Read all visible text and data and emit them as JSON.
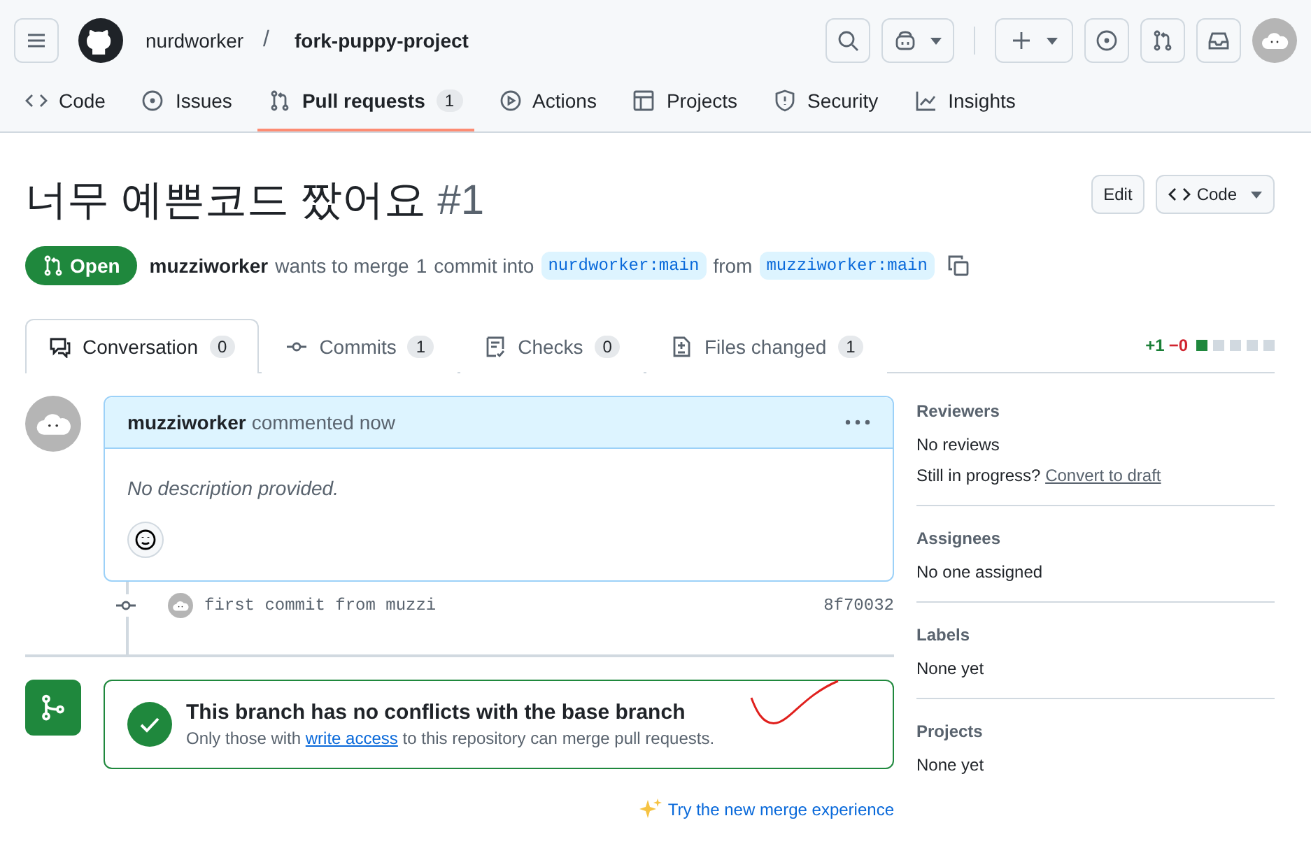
{
  "header": {
    "owner": "nurdworker",
    "separator": "/",
    "repo": "fork-puppy-project"
  },
  "repo_tabs": [
    {
      "label": "Code",
      "selected": false
    },
    {
      "label": "Issues",
      "selected": false
    },
    {
      "label": "Pull requests",
      "count": "1",
      "selected": true
    },
    {
      "label": "Actions",
      "selected": false
    },
    {
      "label": "Projects",
      "selected": false
    },
    {
      "label": "Security",
      "selected": false
    },
    {
      "label": "Insights",
      "selected": false
    }
  ],
  "pr": {
    "title": "너무 예쁜코드 짰어요",
    "number": "#1",
    "state": "Open",
    "author": "muzziworker",
    "merge_text_1": "wants to merge",
    "commit_count": "1",
    "merge_text_2": "commit into",
    "base": "nurdworker:main",
    "from": "from",
    "head": "muzziworker:main",
    "edit_button": "Edit",
    "code_button": "Code"
  },
  "pr_tabs": [
    {
      "label": "Conversation",
      "count": "0",
      "selected": true
    },
    {
      "label": "Commits",
      "count": "1",
      "selected": false
    },
    {
      "label": "Checks",
      "count": "0",
      "selected": false
    },
    {
      "label": "Files changed",
      "count": "1",
      "selected": false
    }
  ],
  "diffstat": {
    "added": "+1",
    "removed": "−0",
    "blocks": [
      {
        "kind": "added"
      },
      {
        "kind": "neutral"
      },
      {
        "kind": "neutral"
      },
      {
        "kind": "neutral"
      },
      {
        "kind": "neutral"
      }
    ]
  },
  "comment": {
    "author": "muzziworker",
    "action": "commented now",
    "body": "No description provided."
  },
  "commit": {
    "message": "first commit from muzzi",
    "sha": "8f70032"
  },
  "merge": {
    "title": "This branch has no conflicts with the base branch",
    "text_before": "Only those with",
    "link": "write access",
    "text_after": "to this repository can merge pull requests.",
    "try_link": "Try the new merge experience"
  },
  "sidebar": [
    {
      "heading": "Reviewers",
      "lines": [
        {
          "text": "No reviews"
        },
        {
          "text": "Still in progress?",
          "link": "Convert to draft"
        }
      ]
    },
    {
      "heading": "Assignees",
      "lines": [
        {
          "text": "No one assigned"
        }
      ]
    },
    {
      "heading": "Labels",
      "lines": [
        {
          "text": "None yet"
        }
      ]
    },
    {
      "heading": "Projects",
      "lines": [
        {
          "text": "None yet"
        }
      ]
    }
  ]
}
